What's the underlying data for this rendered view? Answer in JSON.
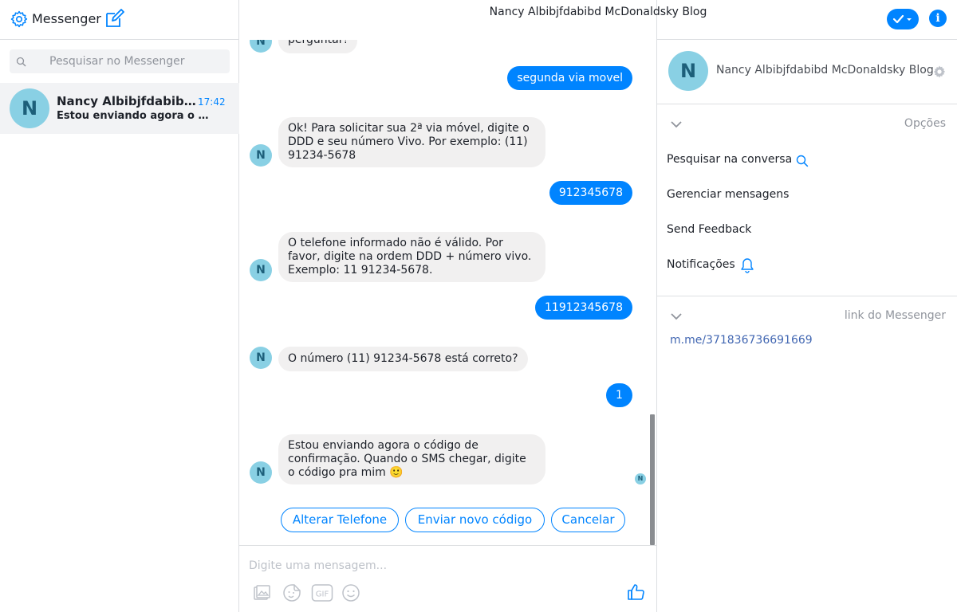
{
  "app": {
    "title": "Messenger",
    "colors": {
      "accent": "#0084ff",
      "avatar_bg": "#89d0e4",
      "avatar_fg": "#1d5f7a"
    }
  },
  "sidebar": {
    "search_placeholder": "Pesquisar no Messenger",
    "threads": [
      {
        "avatar_letter": "N",
        "name": "Nancy Albibjfdabibd McDonaldsky Blog",
        "time": "17:42",
        "snippet": "Estou enviando agora o código de confirmação. Quando o SMS chegar, digite o código pra mim"
      }
    ]
  },
  "conversation": {
    "title": "Nancy Albibjfdabibd McDonaldsky Blog",
    "avatar_letter": "N",
    "messages": [
      {
        "from": "them",
        "text": "perguntar!"
      },
      {
        "from": "me",
        "text": "segunda via movel"
      },
      {
        "from": "them",
        "text": "Ok! Para solicitar sua 2ª via móvel, digite o DDD e seu número Vivo. Por exemplo: (11) 91234-5678"
      },
      {
        "from": "me",
        "text": "912345678"
      },
      {
        "from": "them",
        "text": "O telefone informado não é válido. Por favor, digite na ordem DDD + número vivo. Exemplo: 11 91234-5678."
      },
      {
        "from": "me",
        "text": "11912345678"
      },
      {
        "from": "them",
        "text": "O número (11) 91234-5678 está correto?"
      },
      {
        "from": "me",
        "text": "1"
      },
      {
        "from": "them",
        "text": "Estou enviando agora o código de confirmação. Quando o SMS chegar, digite o código pra mim",
        "emoji": "🙂"
      }
    ],
    "quick_replies": [
      "Alterar Telefone",
      "Enviar novo código",
      "Cancelar"
    ],
    "composer_placeholder": "Digite uma mensagem...",
    "composer_tools": [
      "image-icon",
      "sticker-icon",
      "gif-icon",
      "emoji-icon",
      "like-icon"
    ]
  },
  "details": {
    "profile_name": "Nancy Albibjfdabibd McDonaldsky Blog",
    "avatar_letter": "N",
    "options_label": "Opções",
    "options": [
      {
        "label": "Pesquisar na conversa",
        "icon": "search-icon"
      },
      {
        "label": "Gerenciar mensagens",
        "icon": ""
      },
      {
        "label": "Send Feedback",
        "icon": ""
      },
      {
        "label": "Notificações",
        "icon": "bell-icon"
      }
    ],
    "link_label": "link do Messenger",
    "link_url": "m.me/371836736691669"
  }
}
